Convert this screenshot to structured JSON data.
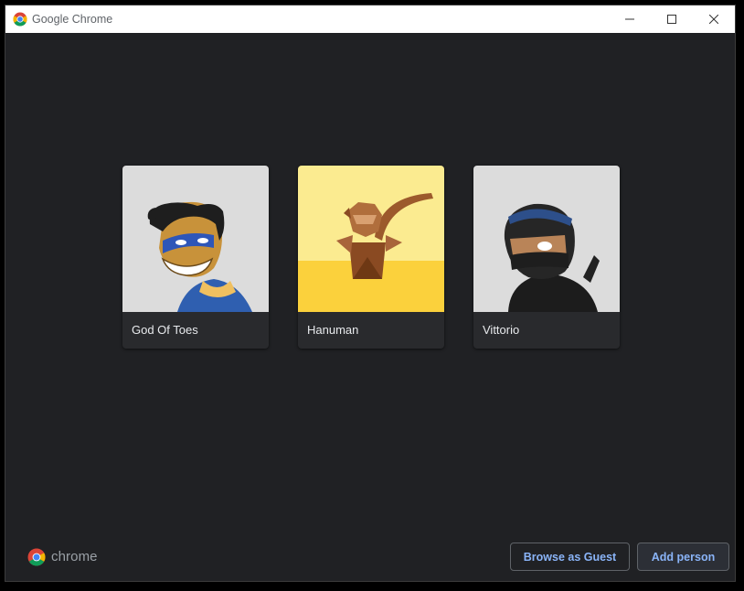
{
  "window": {
    "title": "Google Chrome"
  },
  "profiles": [
    {
      "name": "God Of Toes",
      "avatar": "superhero-avatar"
    },
    {
      "name": "Hanuman",
      "avatar": "origami-monkey-avatar"
    },
    {
      "name": "Vittorio",
      "avatar": "ninja-avatar"
    }
  ],
  "footer": {
    "brand_text": "chrome",
    "guest_label": "Browse as Guest",
    "add_label": "Add person"
  },
  "colors": {
    "background": "#202124",
    "card": "#292a2d",
    "accent": "#8ab4f8"
  }
}
